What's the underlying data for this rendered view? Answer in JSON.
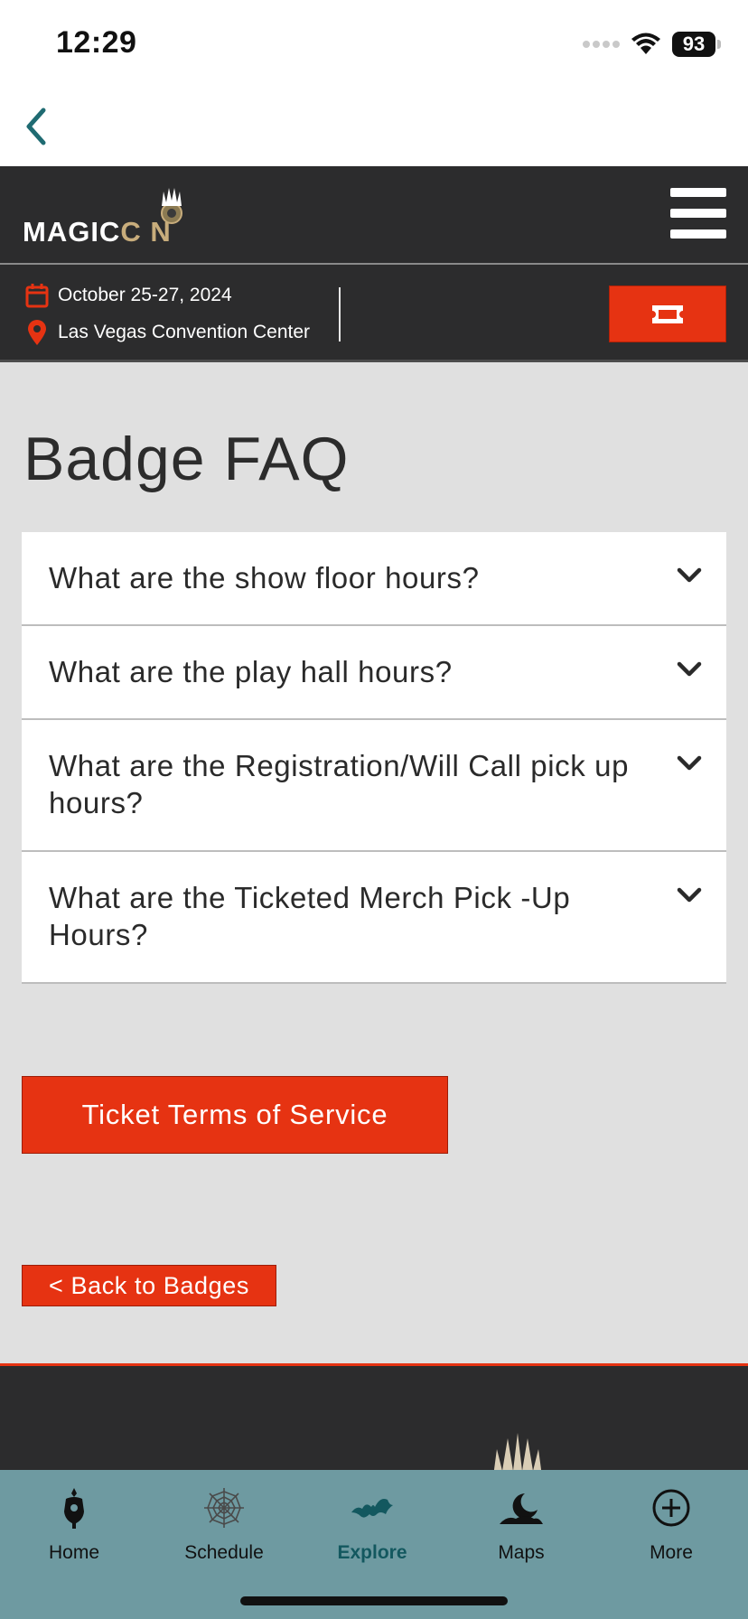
{
  "status_bar": {
    "time": "12:29",
    "battery": "93"
  },
  "header": {
    "logo_magic": "MAGIC",
    "logo_con": "C N"
  },
  "event_info": {
    "date": "October 25-27, 2024",
    "venue": "Las Vegas Convention Center"
  },
  "page": {
    "title": "Badge FAQ",
    "faq": [
      {
        "question": "What are the show floor hours?"
      },
      {
        "question": "What are the play hall hours?"
      },
      {
        "question": "What are the Registration/Will Call pick up hours?"
      },
      {
        "question": "What are the Ticketed Merch Pick -Up Hours?"
      }
    ],
    "tos_button": "Ticket Terms of Service",
    "back_button": "< Back to Badges"
  },
  "tab_bar": {
    "items": [
      {
        "label": "Home",
        "icon": "home-icon"
      },
      {
        "label": "Schedule",
        "icon": "spiderweb-icon"
      },
      {
        "label": "Explore",
        "icon": "bat-icon"
      },
      {
        "label": "Maps",
        "icon": "moon-icon"
      },
      {
        "label": "More",
        "icon": "plus-circle-icon"
      }
    ],
    "active": "Explore"
  },
  "colors": {
    "accent_red": "#e63312",
    "header_dark": "#2c2c2d",
    "tab_bar_bg": "#6e9aa1",
    "active_tab": "#13585f",
    "back_chevron": "#1f6b72"
  }
}
